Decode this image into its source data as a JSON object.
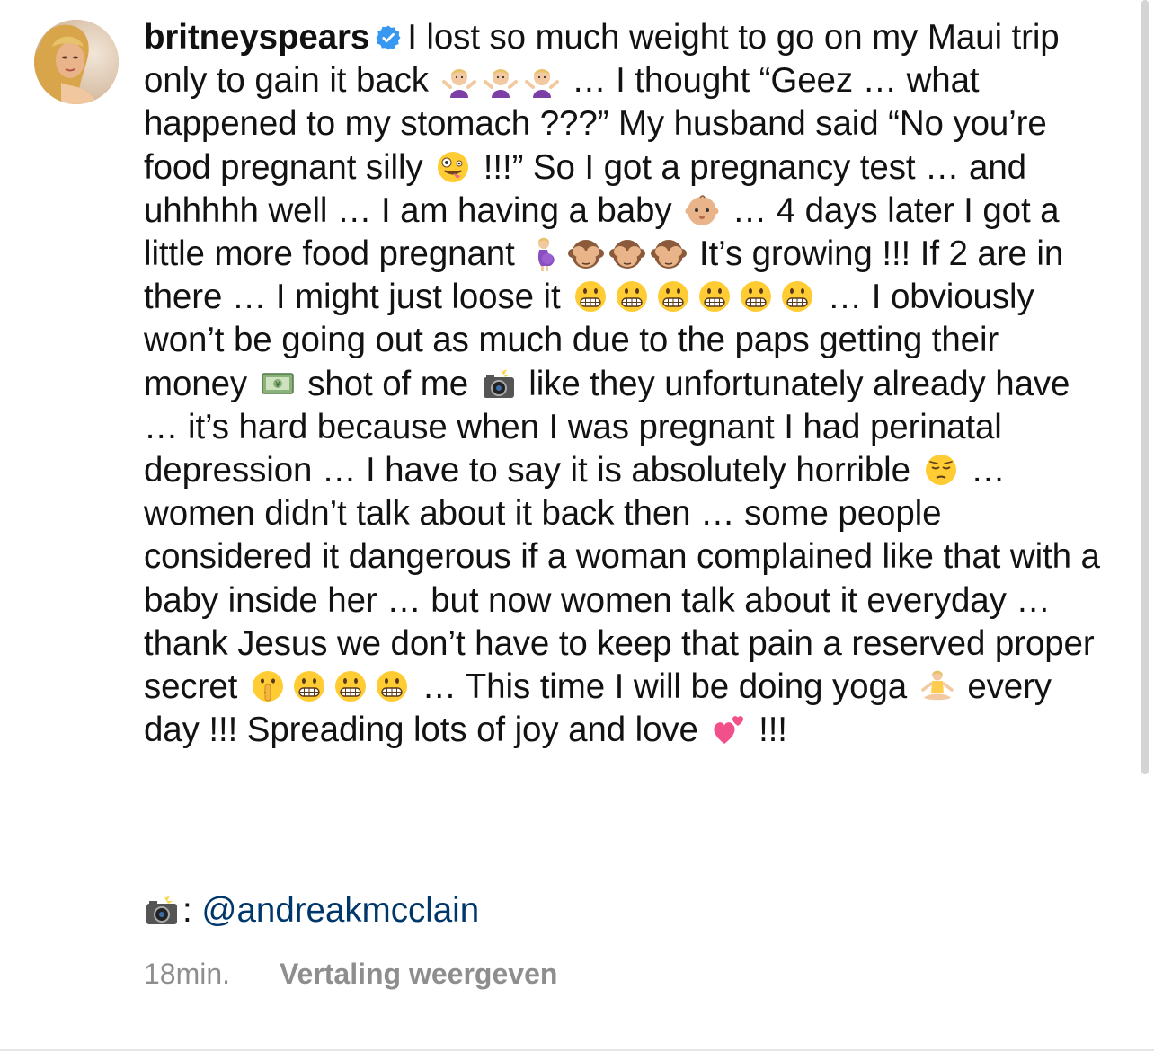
{
  "post": {
    "username": "britneyspears",
    "verified": true,
    "caption_segments": [
      "I lost so much weight to go on my Maui trip only to gain it back",
      "… I thought “Geez … what happened to my stomach ???” My husband said “No you’re food pregnant silly",
      "!!!” So I got a pregnancy test … and uhhhhh well … I am having a baby",
      "… 4 days later I got a little more food pregnant",
      "It’s growing !!! If 2 are in there … I might just loose it",
      "… I obviously won’t be going out as much due to the paps getting their money",
      "shot of me",
      "like they unfortunately already have … it’s hard because when I was pregnant I had perinatal depression … I have to say it is absolutely horrible",
      "… women didn’t talk about it back then … some people considered it dangerous if a woman complained like that with a baby inside her … but now women talk about it everyday … thank Jesus we don’t have to keep that pain a reserved proper secret",
      "… This time I will be doing yoga",
      "every day !!! Spreading lots of joy and love",
      "!!!"
    ],
    "photo_credit_sep": ":",
    "photo_credit_mention": "@andreakmcclain",
    "timestamp": "18min.",
    "translate_label": "Vertaling weergeven"
  },
  "icons": {
    "verified": "verified-badge-icon",
    "shrug": "person-shrugging-emoji",
    "crazy": "zany-face-emoji",
    "baby": "baby-emoji",
    "pregnant": "pregnant-woman-emoji",
    "see_no_evil": "see-no-evil-monkey-emoji",
    "grimace": "grimacing-face-emoji",
    "money": "banknote-emoji",
    "camera_flash": "camera-with-flash-emoji",
    "pensive": "pensive-face-emoji",
    "shush": "shushing-face-emoji",
    "yoga": "person-lotus-position-emoji",
    "hearts": "two-hearts-emoji"
  },
  "colors": {
    "verified_blue": "#3897f0",
    "mention_blue": "#00376b",
    "meta_gray": "#8e8e8e"
  }
}
